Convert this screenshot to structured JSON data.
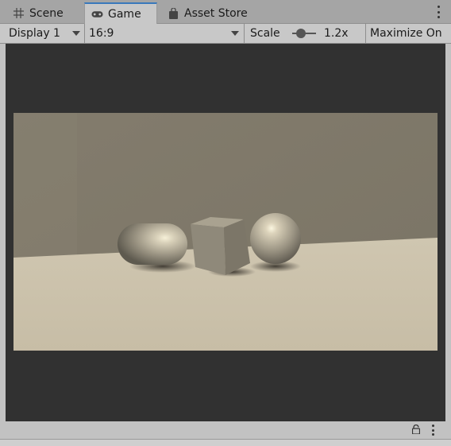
{
  "tabs": [
    {
      "label": "Scene",
      "icon": "grid-icon",
      "active": false
    },
    {
      "label": "Game",
      "icon": "gamepad-icon",
      "active": true
    },
    {
      "label": "Asset Store",
      "icon": "shopping-bag-icon",
      "active": false
    }
  ],
  "toolbar": {
    "display_value": "Display 1",
    "aspect_value": "16:9",
    "scale_label": "Scale",
    "scale_value": "1.2x",
    "scale_slider_fraction": 0.2,
    "maximize_label": "Maximize On"
  },
  "colors": {
    "accent": "#3a79bb",
    "viewport_bg": "#313131",
    "panel_bg": "#c8c8c8",
    "tab_bg": "#a5a5a5"
  },
  "game_view": {
    "objects": [
      "capsule",
      "cube",
      "sphere"
    ]
  }
}
